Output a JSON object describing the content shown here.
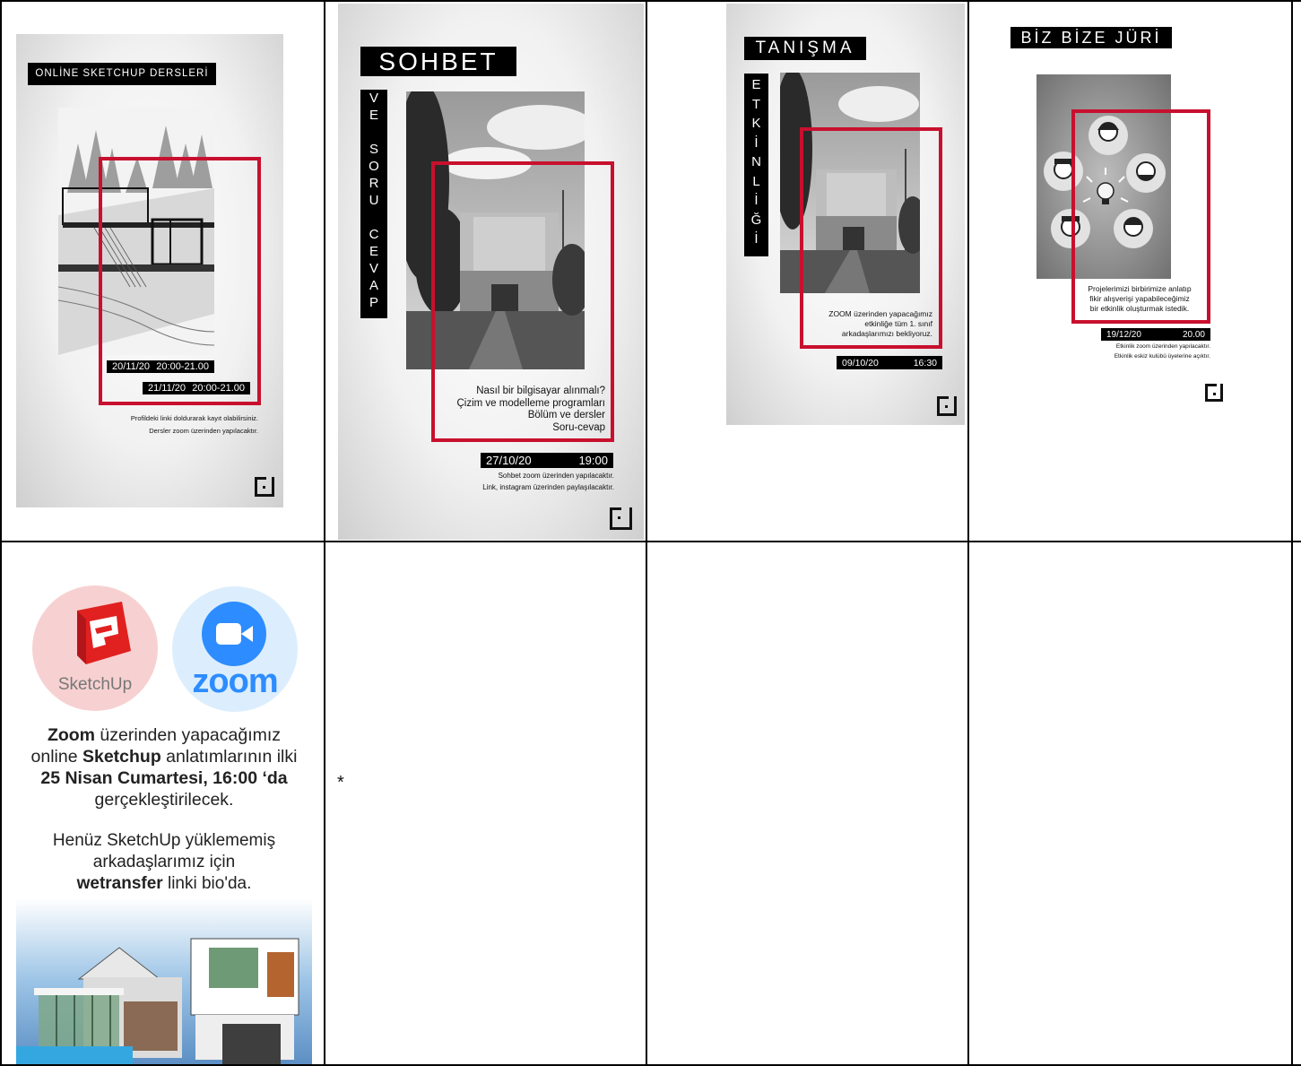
{
  "posters": {
    "p1": {
      "title": "ONLİNE SKETCHUP DERSLERİ",
      "date1": "20/11/20",
      "time1": "20:00-21.00",
      "date2": "21/11/20",
      "time2": "20:00-21.00",
      "note1": "Profildeki linki doldurarak kayıt olabilirsiniz.",
      "note2": "Dersler zoom üzerinden yapılacaktır."
    },
    "p2": {
      "title": "SOHBET",
      "vertical": [
        "V",
        "E",
        "",
        "S",
        "O",
        "R",
        "U",
        "",
        "C",
        "E",
        "V",
        "A",
        "P"
      ],
      "info": [
        "Nasıl bir bilgisayar alınmalı?",
        "Çizim ve modelleme programları",
        "Bölüm ve dersler",
        "Soru-cevap"
      ],
      "date": "27/10/20",
      "time": "19:00",
      "note1": "Sohbet zoom üzerinden yapılacaktır.",
      "note2": "Link, instagram üzerinden paylaşılacaktır."
    },
    "p3": {
      "title": "TANIŞMA",
      "vertical": [
        "E",
        "T",
        "K",
        "İ",
        "N",
        "L",
        "İ",
        "Ğ",
        "İ"
      ],
      "info": [
        "ZOOM üzerinden yapacağımız",
        "etkinliğe tüm 1. sınıf",
        "arkadaşlarımızı bekliyoruz."
      ],
      "date": "09/10/20",
      "time": "16:30"
    },
    "p4": {
      "title": "BİZ BİZE JÜRİ",
      "info": [
        "Projelerimizi birbirimize anlatıp",
        "fikir alışverişi yapabileceğimiz",
        "bir etkinlik oluşturmak istedik."
      ],
      "date": "19/12/20",
      "time": "20.00",
      "note1": "Etkinlik zoom üzerinden yapılacaktır.",
      "note2": "Etkinlik eskiz kulübü üyelerine açıktır."
    },
    "p5": {
      "sketchup_label": "SketchUp",
      "zoom_label": "zoom",
      "line1_bold": "Zoom",
      "line1_rest": " üzerinden yapacağımız",
      "line2_pre": "online ",
      "line2_bold": "Sketchup",
      "line2_rest": " anlatımlarının ilki",
      "line3": "25 Nisan Cumartesi, 16:00 ‘da",
      "line4": "gerçekleştirilecek.",
      "line5": "Henüz SketchUp yüklememiş",
      "line6": "arkadaşlarımız için",
      "line7_bold": "wetransfer",
      "line7_rest": " linki bio'da."
    }
  },
  "asterisk": "*",
  "colors": {
    "accent_red": "#c8102e",
    "sketchup_red": "#e0211f",
    "zoom_blue": "#2d8cff"
  }
}
